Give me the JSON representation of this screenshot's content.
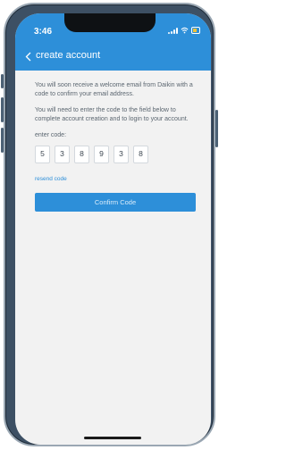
{
  "status_bar": {
    "time": "3:46"
  },
  "nav": {
    "title": "create account",
    "back_icon": "chevron-left-icon"
  },
  "content": {
    "paragraph_1": "You will soon receive a welcome email from Daikin with a code to confirm your email address.",
    "paragraph_2": "You will need to enter the code to the field below to complete account creation and to login to your account.",
    "code_label": "enter code:",
    "code_digits": [
      "5",
      "3",
      "8",
      "9",
      "3",
      "8"
    ],
    "resend_label": "resend code",
    "confirm_label": "Confirm Code"
  },
  "colors": {
    "accent": "#2d8fd9",
    "background": "#f2f2f2",
    "text": "#5b6670",
    "phone_frame": "#3d5064"
  }
}
